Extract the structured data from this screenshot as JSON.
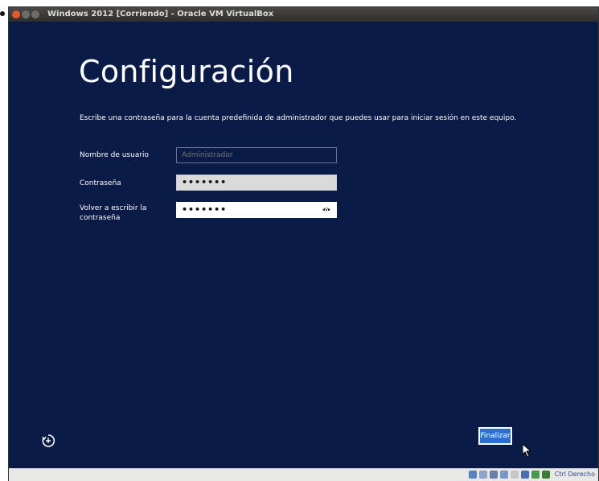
{
  "window": {
    "title": "Windows 2012 [Corriendo] - Oracle VM VirtualBox"
  },
  "setup": {
    "heading": "Configuración",
    "description": "Escribe una contraseña para la cuenta predefinida de administrador que puedes usar para iniciar sesión en este equipo.",
    "username_label": "Nombre de usuario",
    "username_placeholder": "Administrador",
    "password_label": "Contraseña",
    "password_value": "•••••••",
    "confirm_label": "Volver a escribir la contraseña",
    "confirm_value": "•••••••",
    "finish_button": "Finalizar"
  },
  "statusbar": {
    "host_key": "Ctrl Derecho"
  },
  "colors": {
    "background": "#0b1b47",
    "accent": "#2b6fd1"
  }
}
